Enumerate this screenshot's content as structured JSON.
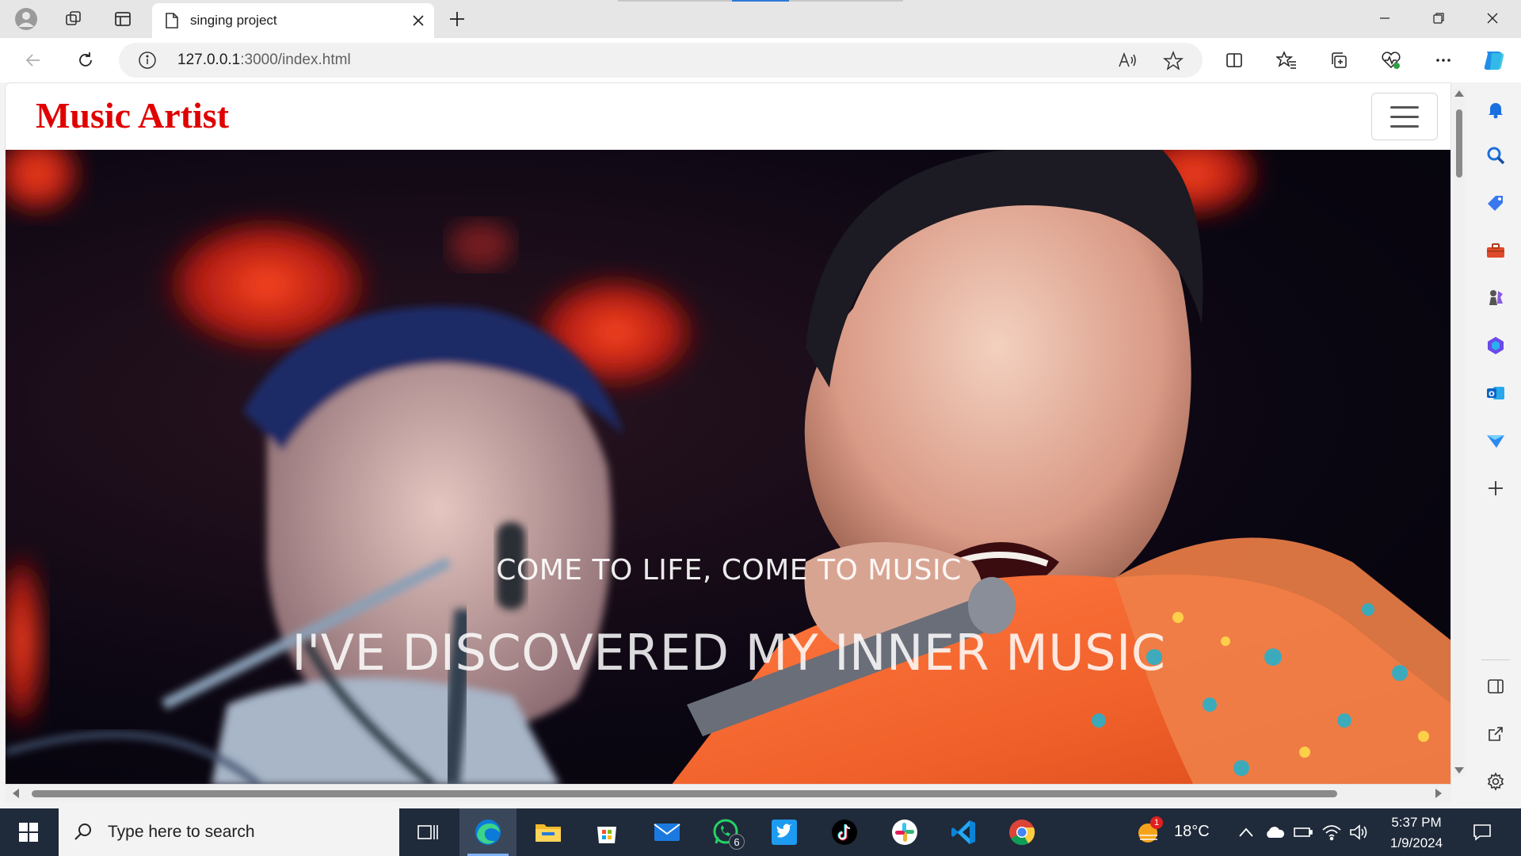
{
  "browser": {
    "tab_title": "singing project",
    "url_host": "127.0.0.1",
    "url_path": ":3000/index.html"
  },
  "page": {
    "brand": "Music Artist",
    "hero_subtitle": "COME TO LIFE, COME TO MUSIC",
    "hero_title": "I'VE DISCOVERED MY INNER MUSIC"
  },
  "taskbar": {
    "search_placeholder": "Type here to search",
    "whatsapp_badge": "6",
    "weather_badge": "1",
    "temperature": "18°C",
    "time": "5:37 PM",
    "date": "1/9/2024"
  },
  "colors": {
    "brand": "#e00000",
    "taskbar": "#1f2a3a"
  }
}
